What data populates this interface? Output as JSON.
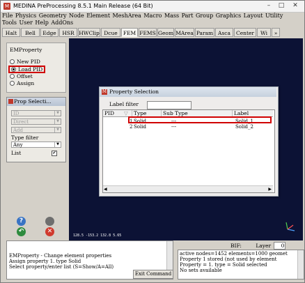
{
  "window": {
    "title": "MEDINA PreProcessing 8.5.1 Main Release (64 Bit)",
    "icon_letter": "M",
    "controls": [
      "–",
      "□",
      "✕"
    ]
  },
  "menu": {
    "row1": [
      "File",
      "Physics",
      "Geometry",
      "Node",
      "Element",
      "MeshArea",
      "Macro",
      "Mass",
      "Part",
      "Group",
      "Graphics",
      "Layout",
      "Utility"
    ],
    "row2": [
      "Tools",
      "User",
      "Help",
      "AddOns"
    ]
  },
  "tabs": [
    "Halt",
    "Bell",
    "Edge",
    "HSR",
    "HWClip",
    "Dcue",
    "FEM",
    "FEMS",
    "Geom",
    "MArea",
    "Param",
    "Asca",
    "Center",
    "Wi",
    "»"
  ],
  "emproperty": {
    "title": "EMProperty",
    "options": [
      "New PID",
      "Load PID",
      "Offset",
      "Assign"
    ],
    "selected": 1
  },
  "prop_selection_panel": {
    "title": "Prop Selecti...",
    "combo1": "ID",
    "combo2": "Direct",
    "combo3": "Add",
    "type_filter_label": "Type filter",
    "type_filter_value": "Any",
    "list_label": "List",
    "list_checked": "✔"
  },
  "viewport": {
    "coords": "128.5  -153.2  132.8   5.65"
  },
  "dialog": {
    "title": "Property Selection",
    "label_filter": "Label filter",
    "columns": [
      "PID",
      "Type",
      "Sub Type",
      "Label"
    ],
    "rows": [
      {
        "pid": "1",
        "type": "Solid",
        "subtype": "---",
        "label": "Solid_1"
      },
      {
        "pid": "2",
        "type": "Solid",
        "subtype": "---",
        "label": "Solid_2"
      }
    ]
  },
  "command": {
    "lines": [
      "EMProperty - Change element properties",
      "Assign property 1. type Solid",
      "Select property/enter list (S=Show/A=All)"
    ],
    "exit_label": "Exit Command"
  },
  "status": {
    "bif_label": "BIF:",
    "layer_label": "Layer",
    "layer_value": "0",
    "lines": [
      "active nodes=1452 elements=1000 geomet",
      "Property 1 stored (not used by element",
      "Property = 1. type = Solid selected",
      "No sets available"
    ]
  },
  "colors": {
    "viewport_bg": "#0c1235",
    "highlight": "#d00000"
  }
}
